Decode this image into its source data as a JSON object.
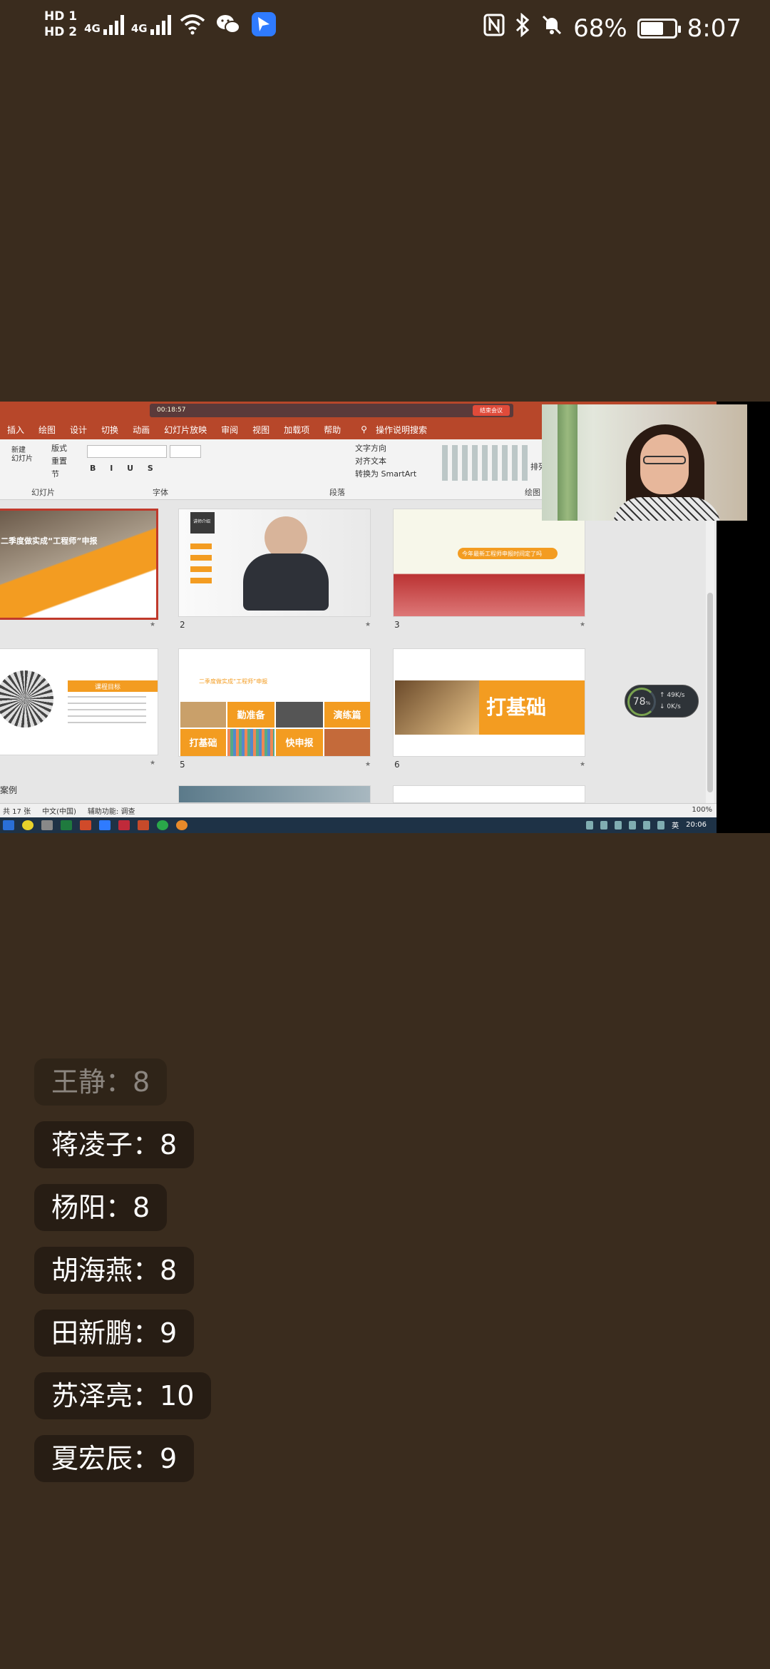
{
  "status_bar": {
    "hd1": "HD 1",
    "hd2": "HD 2",
    "net1": "4G",
    "net2": "4G",
    "battery_percent": "68%",
    "battery_level": 0.68,
    "time": "8:07"
  },
  "meeting_bar": {
    "timer": "00:18:57",
    "end_button": "结束会议"
  },
  "ppt": {
    "menu": [
      "插入",
      "绘图",
      "设计",
      "切换",
      "动画",
      "幻灯片放映",
      "审阅",
      "视图",
      "加载项",
      "帮助"
    ],
    "search_label": "操作说明搜索",
    "ribbon": {
      "new_slide": "新建\n幻灯片",
      "layout": "版式",
      "reset": "重置",
      "section": "节",
      "group_slides": "幻灯片",
      "group_font": "字体",
      "group_paragraph": "段落",
      "group_drawing": "绘图",
      "text_direction": "文字方向",
      "align_text": "对齐文本",
      "convert_smartart": "转换为 SmartArt",
      "arrange": "排列"
    },
    "slides": [
      {
        "num": "",
        "title": "二季度做实成“工程师”申报",
        "selected": true
      },
      {
        "num": "2",
        "title": "讲师介绍"
      },
      {
        "num": "3",
        "title": "今年最新工程师申报时间定了吗"
      },
      {
        "num": "",
        "title": "课程目标"
      },
      {
        "num": "5",
        "title": "二季度做实成“工程师”申报",
        "tiles": [
          "勤准备",
          "演练篇",
          "打基础",
          "快申报"
        ]
      },
      {
        "num": "6",
        "title": "打基础"
      }
    ],
    "partial_label": "案例",
    "statusbar": {
      "slide_count": "共 17 张",
      "language": "中文(中国)",
      "accessibility": "辅助功能: 调查",
      "zoom": "100%"
    },
    "taskbar_time": "20:06",
    "taskbar_ime": "英"
  },
  "net_widget": {
    "value": "78",
    "unit": "%",
    "up": "49K/s",
    "down": "0K/s"
  },
  "chat_items": [
    {
      "name": "王静",
      "score": "8",
      "faded": true
    },
    {
      "name": "蒋凌子",
      "score": "8"
    },
    {
      "name": "杨阳",
      "score": "8"
    },
    {
      "name": "胡海燕",
      "score": "8"
    },
    {
      "name": "田新鹏",
      "score": "9"
    },
    {
      "name": "苏泽亮",
      "score": "10"
    },
    {
      "name": "夏宏辰",
      "score": "9"
    }
  ]
}
